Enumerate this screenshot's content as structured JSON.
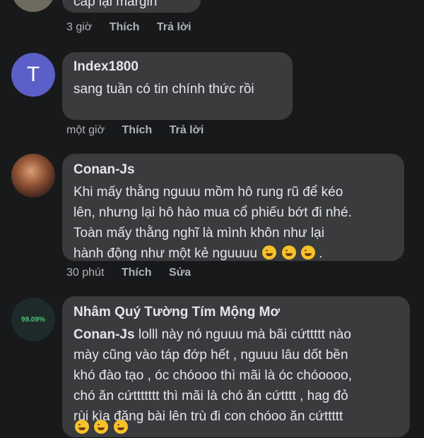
{
  "comments": [
    {
      "author": "",
      "text_lines": [
        "cấp lại margin"
      ],
      "time": "3 giờ",
      "actions": [
        "Thích",
        "Trả lời"
      ]
    },
    {
      "author": "Index1800",
      "avatar_letter": "T",
      "avatar_color": "#5b5fc7",
      "text_lines": [
        "sang tuần có tin chính thức rồi"
      ],
      "time": "một giờ",
      "actions": [
        "Thích",
        "Trả lời"
      ]
    },
    {
      "author": "Conan-Js",
      "text_lines": [
        "Khi mấy thằng nguuu mồm hô rung rũ để kéo",
        "lên, nhưng lại hô hào mua cổ phiếu bớt đi nhé.",
        "Toàn mấy thằng nghĩ là mình khôn như lại",
        "hành động như một kẻ nguuuu"
      ],
      "line4_suffix": ".",
      "time": "30 phút",
      "actions": [
        "Thích",
        "Sửa"
      ]
    },
    {
      "author": "Nhâm Quý Tường Tím Mộng Mơ",
      "avatar_text": "99.09%",
      "mention": "Conan-Js",
      "text_lines": [
        " lolll này nó nguuu mà bãi cứttttt nào",
        "mày cũng vào táp đớp hết , nguuu lâu dốt bền",
        "khó đào tạo , óc chóooo thì mãi là óc chóoooo,",
        "chó ăn cứttttttt thì mãi là chó ăn cứtttt , hag đỏ",
        "rùi kìa đăng bài lên trù đi con chóoo ăn cứttttt"
      ]
    }
  ],
  "icons": {
    "laugh": "rolling-on-floor-laughing-emoji",
    "cry": "crying-emoji"
  },
  "colors": {
    "background": "#18191a",
    "bubble": "#3a3b3c",
    "meta": "#b0b3b8"
  }
}
